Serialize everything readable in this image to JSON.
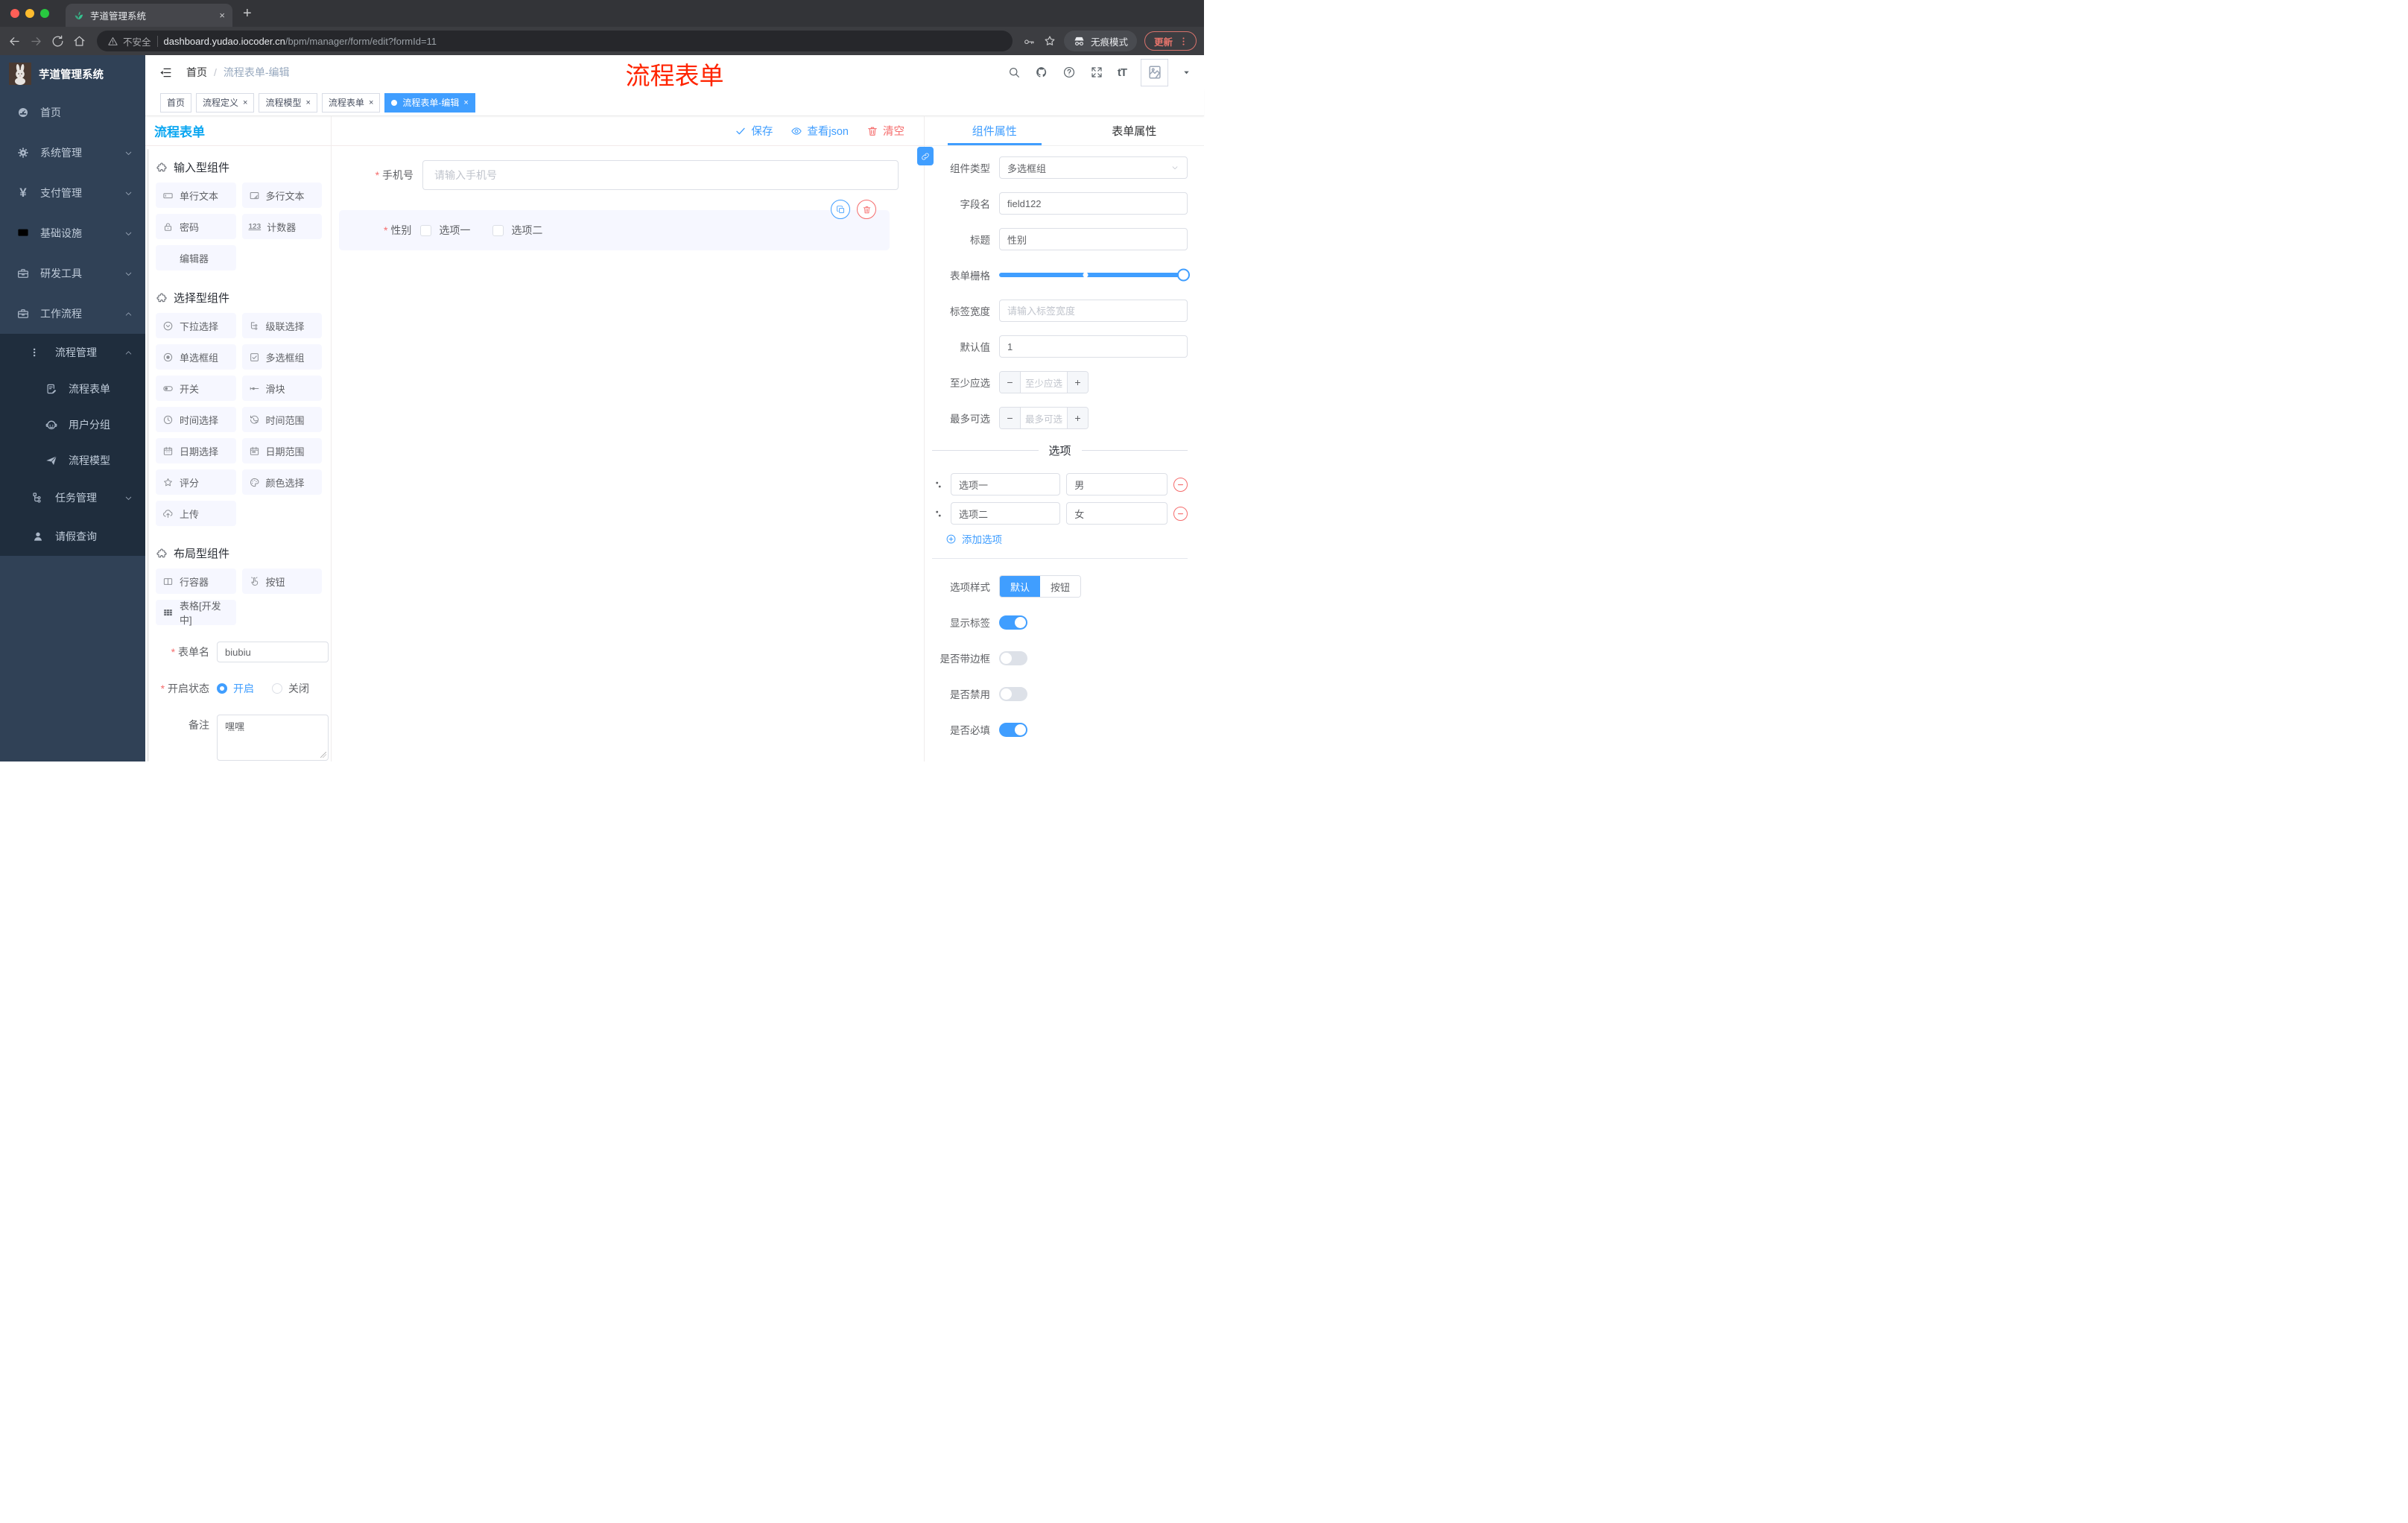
{
  "browser": {
    "tab_title": "芋道管理系统",
    "close_glyph": "×",
    "newtab_glyph": "+",
    "security_label": "不安全",
    "url_host": "dashboard.yudao.iocoder.cn",
    "url_path": "/bpm/manager/form/edit?formId=11",
    "incognito_label": "无痕模式",
    "update_label": "更新"
  },
  "sidebar": {
    "logo_title": "芋道管理系统",
    "items": [
      {
        "label": "首页"
      },
      {
        "label": "系统管理"
      },
      {
        "label": "支付管理"
      },
      {
        "label": "基础设施"
      },
      {
        "label": "研发工具"
      },
      {
        "label": "工作流程"
      }
    ],
    "yen_glyph": "¥",
    "submenu": {
      "group_label": "流程管理",
      "children": [
        {
          "label": "流程表单"
        },
        {
          "label": "用户分组"
        },
        {
          "label": "流程模型"
        }
      ],
      "siblings": [
        {
          "label": "任务管理"
        },
        {
          "label": "请假查询"
        }
      ]
    }
  },
  "header": {
    "breadcrumb": {
      "root": "首页",
      "separator": "/",
      "current": "流程表单-编辑"
    },
    "annotation": "流程表单",
    "font_icon": "tT"
  },
  "tags": {
    "close_glyph": "×",
    "items": [
      {
        "label": "首页"
      },
      {
        "label": "流程定义"
      },
      {
        "label": "流程模型"
      },
      {
        "label": "流程表单"
      },
      {
        "label": "流程表单-编辑"
      }
    ]
  },
  "builder": {
    "panel_title": "流程表单",
    "toolbar": {
      "save": "保存",
      "view_json": "查看json",
      "clear": "清空"
    },
    "sections": {
      "input": {
        "title": "输入型组件",
        "items": [
          "单行文本",
          "多行文本",
          "密码",
          "计数器",
          "编辑器"
        ],
        "num_icon": "123"
      },
      "select": {
        "title": "选择型组件",
        "items": [
          "下拉选择",
          "级联选择",
          "单选框组",
          "多选框组",
          "开关",
          "滑块",
          "时间选择",
          "时间范围",
          "日期选择",
          "日期范围",
          "评分",
          "颜色选择",
          "上传"
        ]
      },
      "layout": {
        "title": "布局型组件",
        "items": [
          "行容器",
          "按钮",
          "表格[开发中]"
        ]
      }
    },
    "form": {
      "name_label": "表单名",
      "name_value": "biubiu",
      "status_label": "开启状态",
      "status_on": "开启",
      "status_off": "关闭",
      "remark_label": "备注",
      "remark_value": "嘿嘿"
    }
  },
  "canvas": {
    "phone": {
      "label": "手机号",
      "placeholder": "请输入手机号"
    },
    "gender": {
      "label": "性别",
      "options": [
        "选项一",
        "选项二"
      ]
    }
  },
  "props": {
    "tabs": {
      "component": "组件属性",
      "form": "表单属性"
    },
    "component_type": {
      "label": "组件类型",
      "value": "多选框组"
    },
    "field_name": {
      "label": "字段名",
      "value": "field122"
    },
    "title": {
      "label": "标题",
      "value": "性别"
    },
    "grid": {
      "label": "表单栅格"
    },
    "label_width": {
      "label": "标签宽度",
      "placeholder": "请输入标签宽度"
    },
    "default_value": {
      "label": "默认值",
      "value": "1"
    },
    "min_checked": {
      "label": "至少应选",
      "placeholder": "至少应选"
    },
    "max_checked": {
      "label": "最多可选",
      "placeholder": "最多可选"
    },
    "stepper": {
      "minus": "−",
      "plus": "+"
    },
    "options": {
      "divider": "选项",
      "rows": [
        {
          "label": "选项一",
          "value": "男"
        },
        {
          "label": "选项二",
          "value": "女"
        }
      ],
      "add": "添加选项"
    },
    "option_style": {
      "label": "选项样式",
      "choices": [
        "默认",
        "按钮"
      ]
    },
    "switches": [
      {
        "label": "显示标签",
        "on": true
      },
      {
        "label": "是否带边框",
        "on": false
      },
      {
        "label": "是否禁用",
        "on": false
      },
      {
        "label": "是否必填",
        "on": true
      }
    ]
  },
  "colors": {
    "accent": "#409eff",
    "danger": "#f56c6c",
    "panel_title_blue": "#0aa6f1",
    "annotation_red": "#ff2400",
    "sidebar_bg": "#304156",
    "submenu_bg": "#1f2d3d",
    "traffic_lights": [
      "#ff5f57",
      "#febc2e",
      "#28c840"
    ],
    "selected_block_bg": "#f6f7ff"
  }
}
